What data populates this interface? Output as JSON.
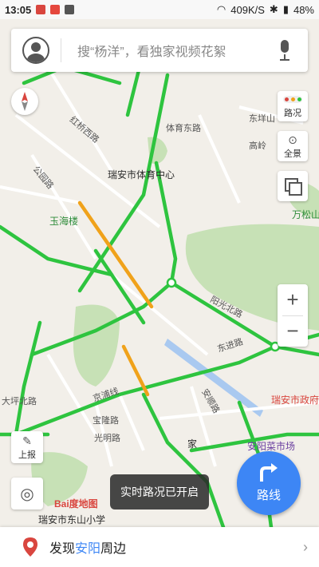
{
  "status_bar": {
    "time": "13:05",
    "speed": "409K/S",
    "battery": "48%"
  },
  "search": {
    "placeholder": "搜“杨洋”，看独家视频花絮"
  },
  "side_buttons": {
    "traffic": "路况",
    "panorama": "全景"
  },
  "map_labels": {
    "poi_center": "瑞安市体育中心",
    "poi_tower": "玉海楼",
    "poi_gov": "瑞安市政府",
    "poi_market": "安阳菜市场",
    "poi_home": "家",
    "poi_school": "瑞安市东山小学",
    "poi_baidu": "Bai度地图",
    "poi_wansongshan": "万松山",
    "poi_dongjie": "东垟山",
    "poi_gaoling": "高岭",
    "road_wanhu": "阳光北路",
    "road_dongning": "东进路",
    "road_jingpu": "京浦线",
    "road_tiyudong": "体育东路",
    "road_hongqiao": "红桥西路",
    "road_gongyuan": "公园路",
    "road_anshun": "安顺路",
    "road_guangming": "光明路",
    "road_baozhong": "宝隆路",
    "road_dahuan": "大坪北路"
  },
  "left_buttons": {
    "report": "上报"
  },
  "route_button": {
    "label": "路线"
  },
  "toast": {
    "text": "实时路况已开启"
  },
  "bottom_bar": {
    "prefix": "发现",
    "highlight": "安阳",
    "suffix": "周边"
  },
  "colors": {
    "road_green": "#2ec43f",
    "road_orange": "#f0a21a",
    "green_area": "#c7e1b6",
    "water": "#a9c9f0",
    "accent_blue": "#3d86f5"
  }
}
